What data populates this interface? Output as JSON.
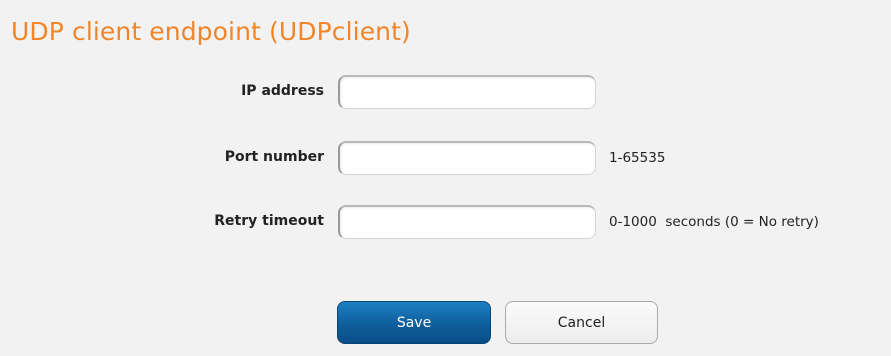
{
  "page": {
    "title": "UDP client endpoint (UDPclient)"
  },
  "form": {
    "fields": [
      {
        "label": "IP address",
        "value": "",
        "hint": ""
      },
      {
        "label": "Port number",
        "value": "",
        "hint": "1-65535"
      },
      {
        "label": "Retry timeout",
        "value": "",
        "hint": "0-1000  seconds (0 = No retry)"
      }
    ]
  },
  "actions": {
    "save_label": "Save",
    "cancel_label": "Cancel"
  },
  "colors": {
    "title": "#f0852a",
    "background": "#f2f2f2",
    "save_button": "#0f5e9c",
    "cancel_button": "#f3f3f3"
  }
}
